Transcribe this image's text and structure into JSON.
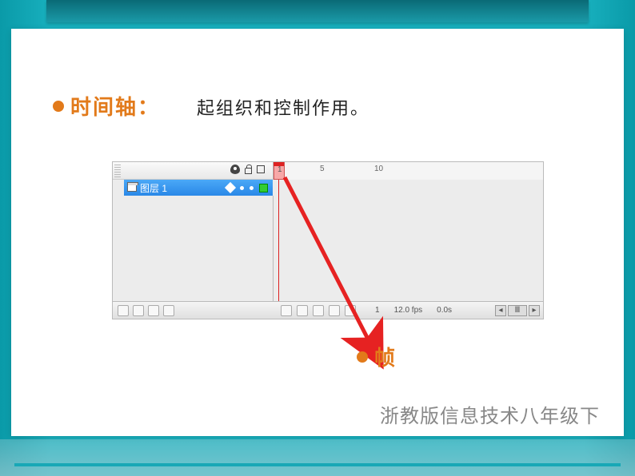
{
  "heading": {
    "label": "时间轴："
  },
  "description": "起组织和控制作用。",
  "timeline": {
    "layer_name": "图层 1",
    "ruler_marks": {
      "m5": "5",
      "m10": "10"
    },
    "status": {
      "frame": "1",
      "fps": "12.0 fps",
      "time": "0.0s"
    }
  },
  "frame_label": "帧",
  "scroll_glyph": "Ⅲ",
  "arrow_glyphs": {
    "left": "◂",
    "right": "▸"
  },
  "footer": "浙教版信息技术八年级下"
}
